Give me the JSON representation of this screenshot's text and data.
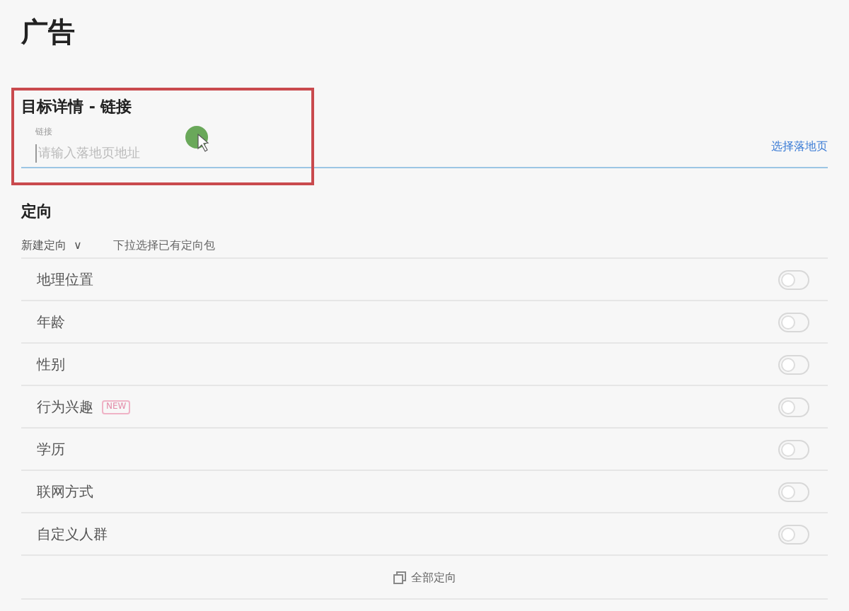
{
  "page_title": "广告",
  "destination": {
    "title": "目标详情 - 链接",
    "field": {
      "label": "链接",
      "placeholder": "请输入落地页地址"
    },
    "link": "选择落地页"
  },
  "targeting": {
    "title": "定向",
    "new_dropdown": {
      "label": "新建定向",
      "caret": "∨"
    },
    "hint": "下拉选择已有定向包",
    "items": [
      {
        "label": "地理位置",
        "on": false
      },
      {
        "label": "年龄",
        "on": false
      },
      {
        "label": "性别",
        "on": false
      },
      {
        "label": "行为兴趣",
        "on": false,
        "badge": "NEW"
      },
      {
        "label": "学历",
        "on": false
      },
      {
        "label": "联网方式",
        "on": false
      },
      {
        "label": "自定义人群",
        "on": false
      }
    ],
    "all_button": "全部定向"
  }
}
